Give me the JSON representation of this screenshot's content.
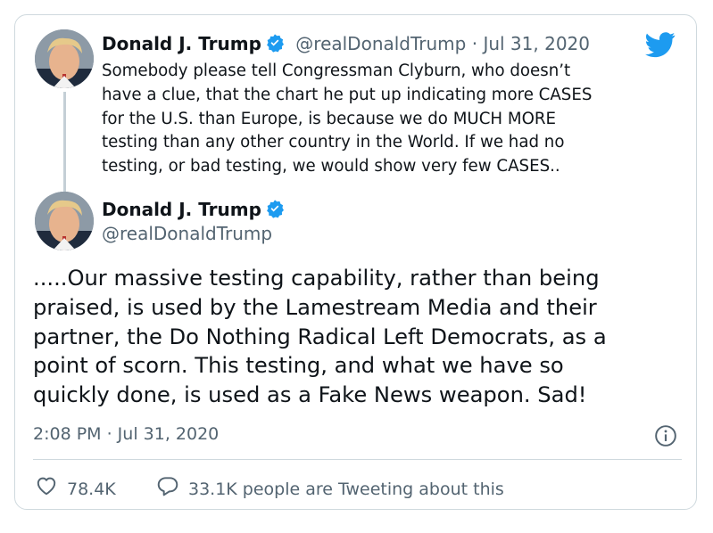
{
  "reply_tweet": {
    "author_name": "Donald J. Trump",
    "handle": "@realDonaldTrump",
    "separator": "·",
    "date": "Jul 31, 2020",
    "text_lines": [
      "Somebody please tell Congressman Clyburn, who doesn’t",
      "have a clue, that the chart he put up indicating more CASES",
      "for the U.S. than Europe, is because we do MUCH MORE",
      "testing than any other country in the World. If we had no",
      "testing, or bad testing, we would show very few CASES.."
    ]
  },
  "main_tweet": {
    "author_name": "Donald J. Trump",
    "handle": "@realDonaldTrump",
    "text_lines": [
      ".....Our massive testing capability, rather than being",
      "praised, is used by the Lamestream Media and their",
      "partner, the Do Nothing Radical Left Democrats, as a",
      "point of scorn. This testing, and what we have so",
      "quickly done, is used as a Fake News weapon. Sad!"
    ],
    "timestamp": "2:08 PM · Jul 31, 2020"
  },
  "actions": {
    "likes": "78.4K",
    "conversation": "33.1K people are Tweeting about this"
  },
  "icons": {
    "verified": "verified-badge-icon",
    "brand": "twitter-bird-icon",
    "info": "info-icon",
    "like": "heart-icon",
    "reply": "speech-bubble-icon"
  },
  "colors": {
    "twitter_blue": "#1d9bf0",
    "muted_text": "#536471",
    "border": "#cfd9de",
    "thread_line": "#c4cfd6"
  }
}
